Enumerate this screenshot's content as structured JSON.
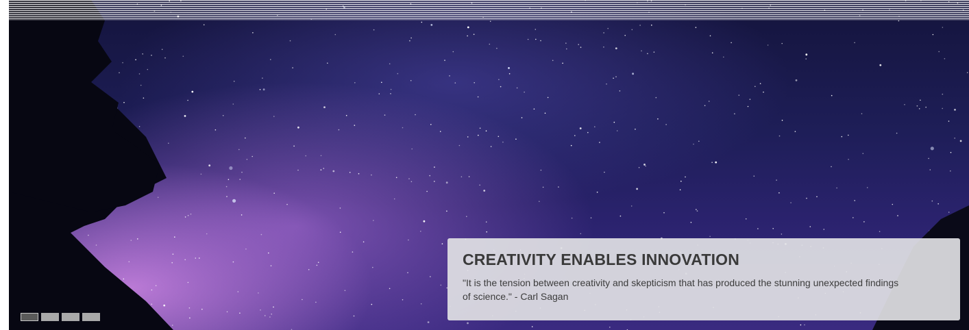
{
  "slide": {
    "title": "CREATIVITY ENABLES INNOVATION",
    "quote": "\"It is the tension between creativity and skepticism that has produced the stunning unexpected findings of science.\" - Carl Sagan",
    "background": "starry-night-sky-image"
  },
  "pager": {
    "count": 4,
    "active_index": 0
  },
  "colors": {
    "caption_background": "#e1e1e4",
    "caption_text": "#3a3a3a",
    "pager_inactive": "#a9a9a9",
    "pager_active": "#5a5a5a"
  }
}
